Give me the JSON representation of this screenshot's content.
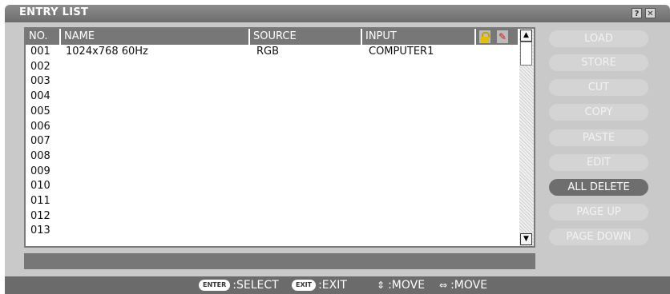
{
  "window": {
    "title": "ENTRY LIST",
    "help_btn": "?",
    "close_btn": "✕"
  },
  "table": {
    "headers": [
      "NO.",
      "NAME",
      "SOURCE",
      "INPUT"
    ],
    "rows": [
      [
        "001",
        "1024x768 60Hz",
        "RGB",
        "COMPUTER1"
      ],
      [
        "002",
        "",
        "",
        ""
      ],
      [
        "003",
        "",
        "",
        ""
      ],
      [
        "004",
        "",
        "",
        ""
      ],
      [
        "005",
        "",
        "",
        ""
      ],
      [
        "006",
        "",
        "",
        ""
      ],
      [
        "007",
        "",
        "",
        ""
      ],
      [
        "008",
        "",
        "",
        ""
      ],
      [
        "009",
        "",
        "",
        ""
      ],
      [
        "010",
        "",
        "",
        ""
      ],
      [
        "011",
        "",
        "",
        ""
      ],
      [
        "012",
        "",
        "",
        ""
      ],
      [
        "013",
        "",
        "",
        ""
      ]
    ]
  },
  "buttons": {
    "load": "LOAD",
    "store": "STORE",
    "cut": "CUT",
    "copy": "COPY",
    "paste": "PASTE",
    "edit": "EDIT",
    "all_delete": "ALL DELETE",
    "page_up": "PAGE UP",
    "page_down": "PAGE DOWN"
  },
  "footer": {
    "enter_key": "ENTER",
    "select": ":SELECT",
    "exit_key": "EXIT",
    "exit": ":EXIT",
    "updown_glyph": "⇕",
    "move1": ":MOVE",
    "leftright_glyph": "⇔",
    "move2": ":MOVE"
  },
  "icons": {
    "lock": "lock-icon",
    "hd": "wrench-icon",
    "scroll_up": "scroll-up-arrow",
    "scroll_down": "scroll-down-arrow"
  }
}
